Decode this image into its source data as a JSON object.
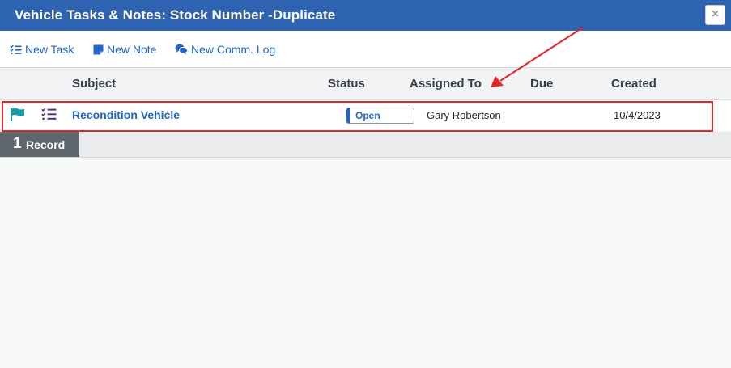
{
  "dialog": {
    "title": "Vehicle Tasks & Notes: Stock Number -Duplicate",
    "close_label": "×"
  },
  "toolbar": {
    "new_task": "New Task",
    "new_note": "New Note",
    "new_comm_log": "New Comm. Log"
  },
  "table": {
    "columns": [
      "Subject",
      "Status",
      "Assigned To",
      "Due",
      "Created"
    ],
    "rows": [
      {
        "subject": "Recondition Vehicle",
        "status": "Open",
        "assigned_to": "Gary Robertson",
        "due": "",
        "created": "10/4/2023"
      }
    ]
  },
  "footer": {
    "record_count": "1",
    "record_label": "Record"
  },
  "colors": {
    "titlebar": "#2d63b0",
    "link": "#2466c7",
    "flag": "#1a9aa4",
    "task_icon": "#5a2d8c",
    "annotation": "#e3262d"
  },
  "icons": [
    "task-list-icon",
    "note-icon",
    "comm-log-icon",
    "flag-icon",
    "task-icon",
    "close-icon",
    "annotation-arrow"
  ]
}
